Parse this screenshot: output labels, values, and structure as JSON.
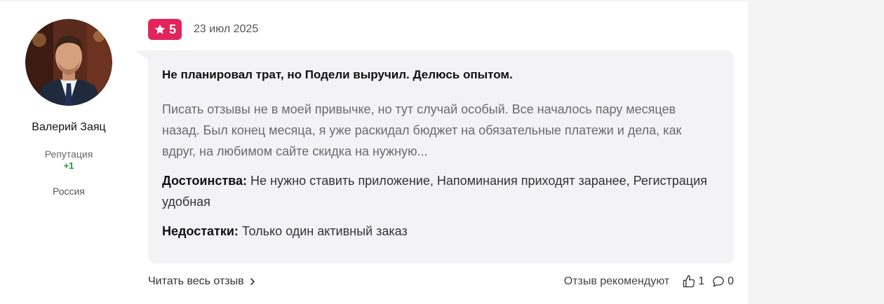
{
  "author": {
    "name": "Валерий Заяц",
    "reputation_label": "Репутация",
    "reputation_value": "+1",
    "country": "Россия"
  },
  "review": {
    "rating": "5",
    "date": "23 июл 2025",
    "title": "Не планировал трат, но Подели выручил. Делюсь опытом.",
    "text": "Писать отзывы не в моей привычке, но тут случай особый. Все началось пару месяцев назад. Был конец месяца, я уже раскидал бюджет на обязательные платежи и дела, как вдруг, на любимом сайте скидка на нужную...",
    "pros_label": "Достоинства:",
    "pros": "Не нужно ставить приложение, Напоминания приходят заранее, Регистрация удобная",
    "cons_label": "Недостатки:",
    "cons": "Только один активный заказ"
  },
  "footer": {
    "read_more": "Читать весь отзыв",
    "recommend_label": "Отзыв рекомендуют",
    "likes": "1",
    "comments": "0"
  },
  "colors": {
    "rating_badge": "#e2245a",
    "reputation_positive": "#1a9b3c",
    "bubble_bg": "#f3f3f5"
  }
}
